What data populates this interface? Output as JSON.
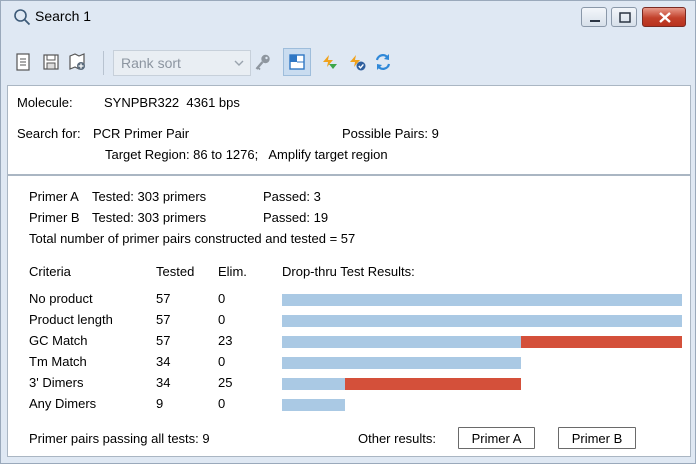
{
  "window": {
    "title": "Search 1"
  },
  "toolbar": {
    "rank_sort": "Rank sort",
    "icons": [
      "notes-icon",
      "save-icon",
      "map-add-icon",
      "key-icon",
      "panel-view-icon",
      "run-search-icon",
      "run-check-icon",
      "refresh-icon"
    ]
  },
  "summary": {
    "molecule_label": "Molecule:",
    "molecule_value": "SYNPBR322  4361 bps",
    "search_label": "Search for:",
    "search_value": "PCR Primer Pair",
    "possible_pairs": "Possible Pairs: 9",
    "target_region": "Target Region: 86 to 1276;   Amplify target region"
  },
  "primers": {
    "primer_a": "Primer A",
    "primer_a_tested": "Tested:  303 primers",
    "primer_a_passed": "Passed: 3",
    "primer_b": "Primer B",
    "primer_b_tested": "Tested:  303 primers",
    "primer_b_passed": "Passed: 19",
    "total": "Total number of primer pairs constructed and tested = 57"
  },
  "criteria": {
    "headers": [
      "Criteria",
      "Tested",
      "Elim.",
      "Drop-thru Test Results:"
    ],
    "rows": [
      {
        "name": "No product",
        "tested": "57",
        "elim": "0",
        "tested_n": 57,
        "elim_n": 0
      },
      {
        "name": "Product length",
        "tested": "57",
        "elim": "0",
        "tested_n": 57,
        "elim_n": 0
      },
      {
        "name": "GC Match",
        "tested": "57",
        "elim": "23",
        "tested_n": 57,
        "elim_n": 23
      },
      {
        "name": "Tm Match",
        "tested": "34",
        "elim": "0",
        "tested_n": 34,
        "elim_n": 0
      },
      {
        "name": "3' Dimers",
        "tested": "34",
        "elim": "25",
        "tested_n": 34,
        "elim_n": 25
      },
      {
        "name": "Any Dimers",
        "tested": "9",
        "elim": "0",
        "tested_n": 9,
        "elim_n": 0
      }
    ],
    "max_tested": 57
  },
  "footer": {
    "passing": "Primer pairs passing all tests: 9",
    "other_results": "Other results:",
    "primer_a_button": "Primer A",
    "primer_b_button": "Primer B"
  },
  "colors": {
    "tested_bar": "#aac9e4",
    "eliminated_bar": "#d4503a"
  }
}
